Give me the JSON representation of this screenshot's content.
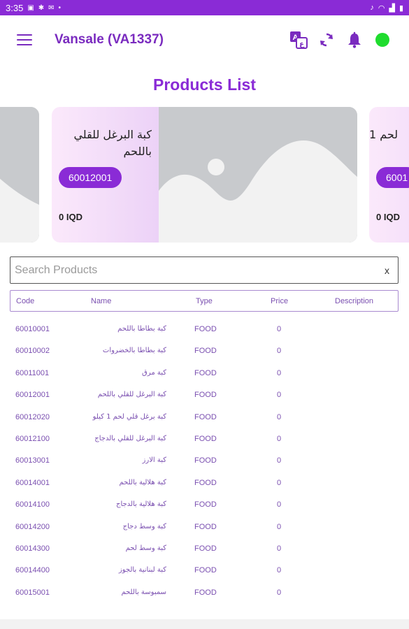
{
  "status_bar": {
    "time": "3:35",
    "left_icons": [
      "gallery-icon",
      "settings-icon",
      "mail-icon"
    ],
    "dot": "•",
    "right_icons": [
      "mute-icon",
      "wifi-icon",
      "signal-icon",
      "battery-icon"
    ]
  },
  "app_bar": {
    "title": "Vansale (VA1337)",
    "icons": [
      "menu-icon",
      "translate-icon",
      "sync-icon",
      "bell-icon",
      "online-status"
    ]
  },
  "page": {
    "title": "Products List"
  },
  "carousel": {
    "cards": [
      {
        "name": "",
        "code": "",
        "price": ""
      },
      {
        "name": "كبة البرغل للقلي باللحم",
        "code": "60012001",
        "price": "0 IQD"
      },
      {
        "name": "لحم 1",
        "code": "6001",
        "price": "0 IQD"
      }
    ]
  },
  "search": {
    "placeholder": "Search Products",
    "clear": "x"
  },
  "table": {
    "headers": {
      "code": "Code",
      "name": "Name",
      "type": "Type",
      "price": "Price",
      "description": "Description"
    },
    "rows": [
      {
        "code": "60010001",
        "name": "كبة بطاطا باللحم",
        "type": "FOOD",
        "price": "0"
      },
      {
        "code": "60010002",
        "name": "كبة بطاطا بالخضروات",
        "type": "FOOD",
        "price": "0"
      },
      {
        "code": "60011001",
        "name": "كبة مرق",
        "type": "FOOD",
        "price": "0"
      },
      {
        "code": "60012001",
        "name": "كبة البرغل للقلي باللحم",
        "type": "FOOD",
        "price": "0"
      },
      {
        "code": "60012020",
        "name": "كبة برغل قلي لحم 1 كيلو",
        "type": "FOOD",
        "price": "0"
      },
      {
        "code": "60012100",
        "name": "كبة البرغل للقلي بالدجاج",
        "type": "FOOD",
        "price": "0"
      },
      {
        "code": "60013001",
        "name": "كبة الارز",
        "type": "FOOD",
        "price": "0"
      },
      {
        "code": "60014001",
        "name": "كبة هلالية باللحم",
        "type": "FOOD",
        "price": "0"
      },
      {
        "code": "60014100",
        "name": "كبة هلالية بالدجاج",
        "type": "FOOD",
        "price": "0"
      },
      {
        "code": "60014200",
        "name": "كبة وسط دجاج",
        "type": "FOOD",
        "price": "0"
      },
      {
        "code": "60014300",
        "name": "كبة وسط لحم",
        "type": "FOOD",
        "price": "0"
      },
      {
        "code": "60014400",
        "name": "كبة لبنانية بالجوز",
        "type": "FOOD",
        "price": "0"
      },
      {
        "code": "60015001",
        "name": "سمبوسة باللحم",
        "type": "FOOD",
        "price": "0"
      }
    ]
  },
  "colors": {
    "primary": "#8a2bd6",
    "accent_green": "#1fdc2e",
    "text_purple": "#7a4fb0"
  }
}
